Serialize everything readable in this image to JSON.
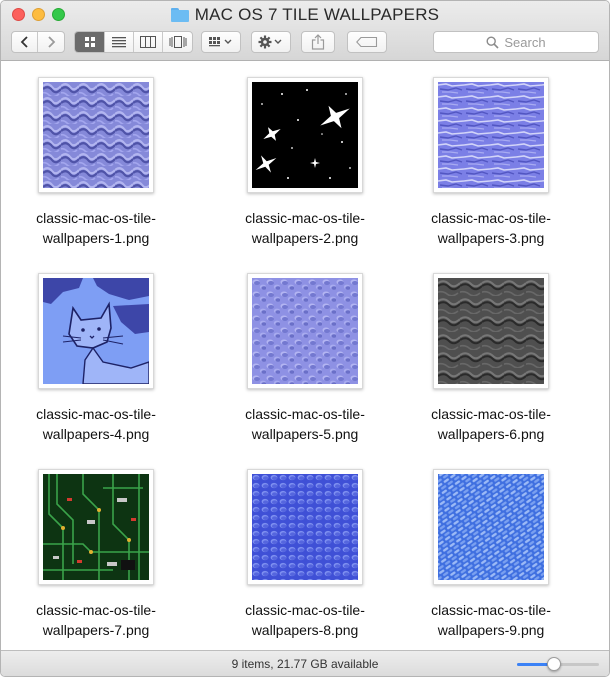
{
  "window": {
    "title": "MAC OS 7 TILE WALLPAPERS"
  },
  "toolbar": {
    "back_icon": "chevron-left-icon",
    "forward_icon": "chevron-right-icon",
    "view_modes": [
      "icon-view",
      "list-view",
      "column-view",
      "cover-flow-view"
    ],
    "active_view": "icon-view",
    "search_placeholder": "Search"
  },
  "files": [
    {
      "name_line1": "classic-mac-os-tile-",
      "name_line2": "wallpapers-1.png",
      "pattern": "blue-emboss",
      "colors": [
        "#8b8fe0",
        "#5a5fb8"
      ]
    },
    {
      "name_line1": "classic-mac-os-tile-",
      "name_line2": "wallpapers-2.png",
      "pattern": "stars",
      "colors": [
        "#000000",
        "#ffffff"
      ]
    },
    {
      "name_line1": "classic-mac-os-tile-",
      "name_line2": "wallpapers-3.png",
      "pattern": "water",
      "colors": [
        "#7c80e8",
        "#c7c9f6"
      ]
    },
    {
      "name_line1": "classic-mac-os-tile-",
      "name_line2": "wallpapers-4.png",
      "pattern": "cat",
      "colors": [
        "#7f9ff5",
        "#2c2f86"
      ]
    },
    {
      "name_line1": "classic-mac-os-tile-",
      "name_line2": "wallpapers-5.png",
      "pattern": "blue-pebble",
      "colors": [
        "#9597e8",
        "#6469c4"
      ]
    },
    {
      "name_line1": "classic-mac-os-tile-",
      "name_line2": "wallpapers-6.png",
      "pattern": "gray-stone",
      "colors": [
        "#555555",
        "#2c2c2c"
      ]
    },
    {
      "name_line1": "classic-mac-os-tile-",
      "name_line2": "wallpapers-7.png",
      "pattern": "circuit",
      "colors": [
        "#0e3b14",
        "#2e8b3a"
      ]
    },
    {
      "name_line1": "classic-mac-os-tile-",
      "name_line2": "wallpapers-8.png",
      "pattern": "blue-bubbles",
      "colors": [
        "#4b5de0",
        "#8fa0f3"
      ]
    },
    {
      "name_line1": "classic-mac-os-tile-",
      "name_line2": "wallpapers-9.png",
      "pattern": "blue-weave",
      "colors": [
        "#4c7ce6",
        "#98b8f6"
      ]
    }
  ],
  "status": {
    "text": "9 items, 21.77 GB available",
    "icon_size_fraction": 0.45
  }
}
